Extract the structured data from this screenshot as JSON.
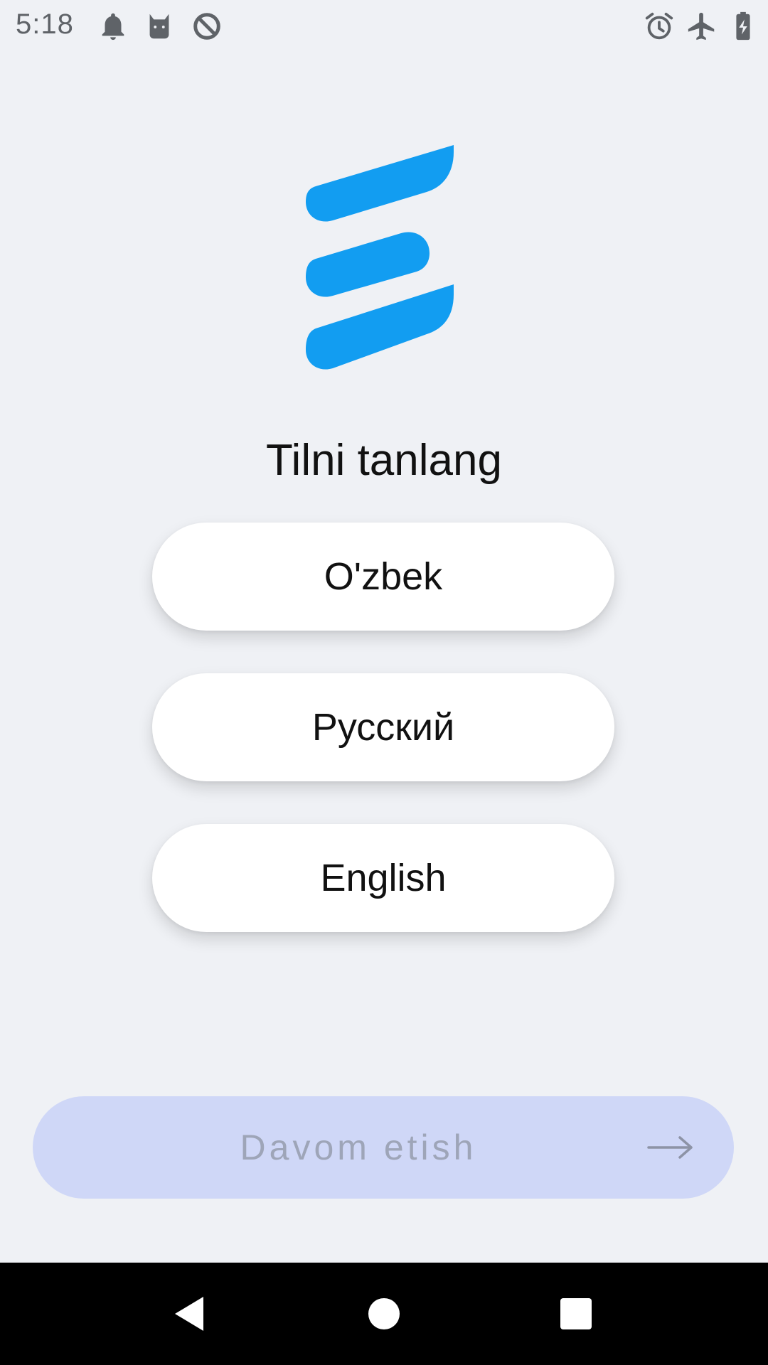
{
  "status_bar": {
    "time": "5:18",
    "left_icons": [
      "bell-icon",
      "cat-icon",
      "data-saver-icon"
    ],
    "right_icons": [
      "alarm-icon",
      "airplane-icon",
      "battery-charging-icon"
    ]
  },
  "logo": {
    "icon": "app-logo-icon",
    "color": "#129DF1"
  },
  "title": "Tilni tanlang",
  "languages": [
    {
      "label": "O'zbek"
    },
    {
      "label": "Русский"
    },
    {
      "label": "English"
    }
  ],
  "continue_button": {
    "label": "Davom etish",
    "icon": "arrow-right-icon",
    "background": "#CFD7F7",
    "text_color": "#9EA5B8"
  },
  "nav_bar": {
    "buttons": [
      "back-icon",
      "home-icon",
      "recents-icon"
    ]
  }
}
